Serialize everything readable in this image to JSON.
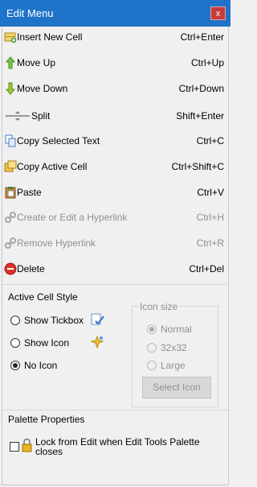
{
  "window": {
    "title": "Edit Menu",
    "close_label": "x"
  },
  "menu_items": [
    {
      "label": "Insert New Cell",
      "shortcut": "Ctrl+Enter"
    },
    {
      "label": "Move Up",
      "shortcut": "Ctrl+Up"
    },
    {
      "label": "Move Down",
      "shortcut": "Ctrl+Down"
    },
    {
      "label": "Split",
      "shortcut": "Shift+Enter"
    },
    {
      "label": "Copy Selected Text",
      "shortcut": "Ctrl+C"
    },
    {
      "label": "Copy Active Cell",
      "shortcut": "Ctrl+Shift+C"
    },
    {
      "label": "Paste",
      "shortcut": "Ctrl+V"
    },
    {
      "label": "Create or Edit a Hyperlink",
      "shortcut": "Ctrl+H"
    },
    {
      "label": "Remove Hyperlink",
      "shortcut": "Ctrl+R"
    },
    {
      "label": "Delete",
      "shortcut": "Ctrl+Del"
    }
  ],
  "active_cell_style": {
    "title": "Active Cell Style",
    "options": [
      "Show Tickbox",
      "Show Icon",
      "No Icon"
    ],
    "selected": "No Icon"
  },
  "icon_size": {
    "title": "Icon size",
    "options": [
      "Normal",
      "32x32",
      "Large"
    ],
    "selected": "Normal",
    "button_label": "Select Icon"
  },
  "palette_properties": {
    "title": "Palette Properties",
    "lock_label": "Lock from Edit when Edit Tools Palette closes",
    "lock_checked": false
  },
  "colors": {
    "titlebar": "#1f73c9",
    "close_button": "#c63b3b"
  }
}
